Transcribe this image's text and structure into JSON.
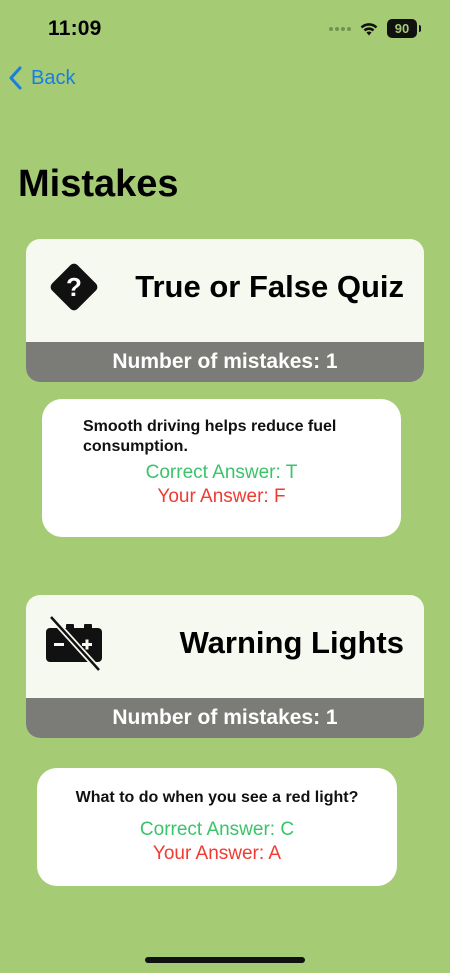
{
  "status": {
    "time": "11:09",
    "battery": "90"
  },
  "nav": {
    "back_label": "Back"
  },
  "title": "Mistakes",
  "sections": [
    {
      "category": "True or False Quiz",
      "icon": "question-diamond-icon",
      "mistakes_label": "Number of mistakes: 1",
      "mistake": {
        "question": "Smooth driving helps reduce fuel consumption.",
        "correct": "Correct Answer: T",
        "yours": "Your Answer: F"
      }
    },
    {
      "category": "Warning Lights",
      "icon": "battery-warning-icon",
      "mistakes_label": "Number of mistakes: 1",
      "mistake": {
        "question": "What to do when you see a red light?",
        "correct": "Correct Answer: C",
        "yours": "Your Answer: A"
      }
    }
  ],
  "colors": {
    "background": "#a5cc74",
    "link": "#1a7de0",
    "correct": "#3ac46a",
    "wrong": "#f03a32",
    "bar": "#7b7c78"
  }
}
